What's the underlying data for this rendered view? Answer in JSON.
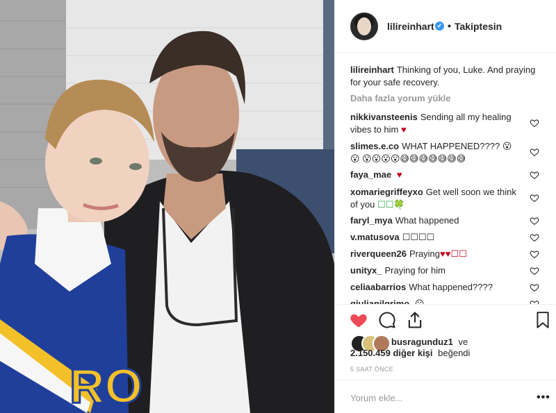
{
  "header": {
    "username": "lilireinhart",
    "verified_mark": "✔",
    "separator": "•",
    "follow_status": "Takiptesin"
  },
  "caption": {
    "username": "lilireinhart",
    "text": "Thinking of you, Luke. And praying for your safe recovery."
  },
  "load_more": "Daha fazla yorum yükle",
  "comments": [
    {
      "username": "nikkivansteenis",
      "text": "Sending all my healing vibes to him",
      "emoji": "♥"
    },
    {
      "username": "slimes.e.co",
      "text": "WHAT HAPPENED????",
      "emoji": "😮😮 😮😮😮😮😅😅😅😅😅😅😅"
    },
    {
      "username": "faya_mae",
      "text": "",
      "emoji": "♥"
    },
    {
      "username": "xomariegriffeyxo",
      "text": "Get well soon we think of you",
      "emoji": "☐☐🍀"
    },
    {
      "username": "faryl_mya",
      "text": "What happened",
      "emoji": ""
    },
    {
      "username": "v.matusova",
      "text": "☐☐☐☐",
      "emoji": ""
    },
    {
      "username": "riverqueen26",
      "text": "Praying",
      "emoji": "♥♥☐☐"
    },
    {
      "username": "unityx_",
      "text": "Praying for him",
      "emoji": ""
    },
    {
      "username": "celiaabarrios",
      "text": "What happened????",
      "emoji": ""
    },
    {
      "username": "giulianilgrimo",
      "text": "",
      "emoji": "😮"
    }
  ],
  "likes": {
    "first_user": "busragunduz1",
    "connector": "ve",
    "count_text": "2.150.459 diğer kişi",
    "suffix": "beğendi"
  },
  "timestamp": "5 SAAT ÖNCE",
  "add_comment": {
    "placeholder": "Yorum ekle...",
    "more": "•••"
  },
  "icons": {
    "like": "heart-filled-icon",
    "comment": "comment-bubble-icon",
    "share": "share-icon",
    "save": "bookmark-icon",
    "comment_like": "heart-outline-icon"
  },
  "colors": {
    "like_red": "#ed4956",
    "verified_blue": "#3897f0",
    "muted": "#999999",
    "text": "#262626"
  }
}
